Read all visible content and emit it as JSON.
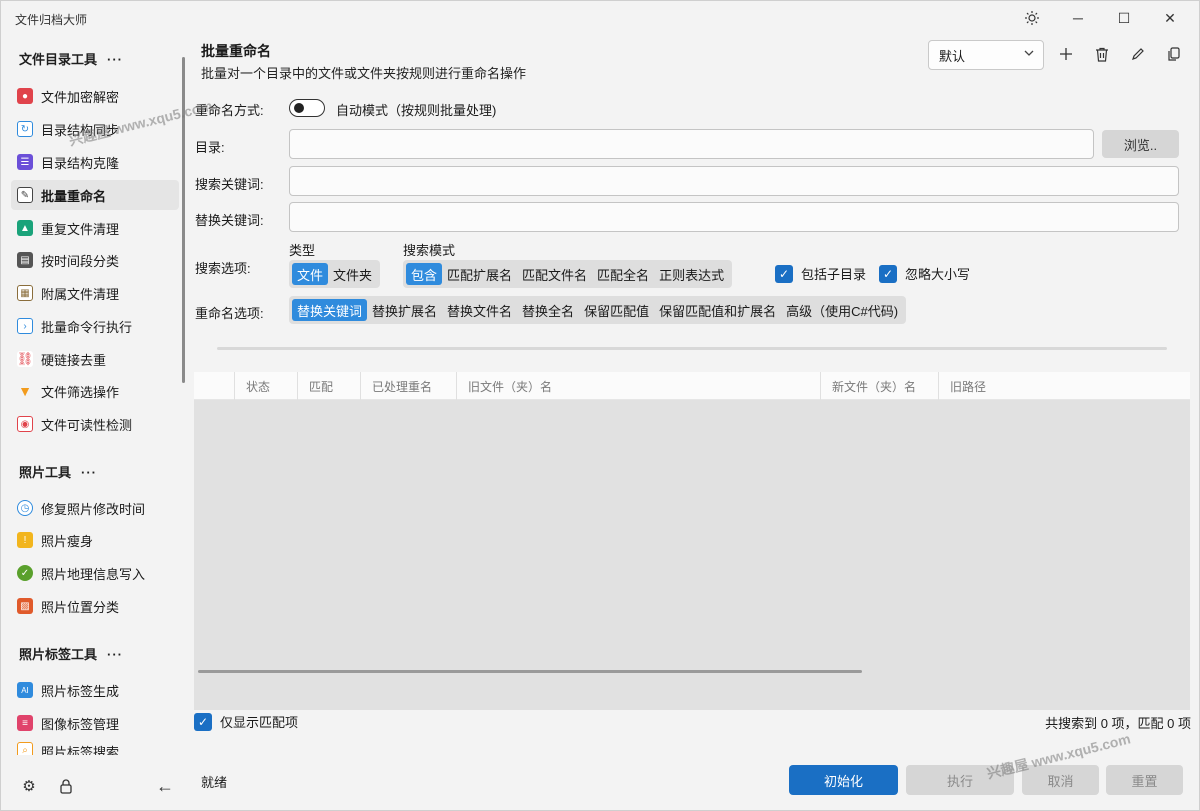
{
  "window": {
    "title": "文件归档大师",
    "theme_icon": "sun-icon",
    "minimize": "─",
    "maximize": "☐",
    "close": "✕"
  },
  "sidebar": {
    "groups": [
      {
        "title": "文件目录工具",
        "dots": "···",
        "items": [
          {
            "label": "文件加密解密",
            "icon": "lock-file-icon",
            "color": "#e0434b"
          },
          {
            "label": "目录结构同步",
            "icon": "sync-icon",
            "color": "#2f8bdd"
          },
          {
            "label": "目录结构克隆",
            "icon": "list-icon",
            "color": "#6b4fd8"
          },
          {
            "label": "批量重命名",
            "icon": "rename-icon",
            "color": "#444444"
          },
          {
            "label": "重复文件清理",
            "icon": "cleanup-icon",
            "color": "#1aa37a"
          },
          {
            "label": "按时间段分类",
            "icon": "printer-icon",
            "color": "#555555"
          },
          {
            "label": "附属文件清理",
            "icon": "document-icon",
            "color": "#8a6d3b"
          },
          {
            "label": "批量命令行执行",
            "icon": "terminal-icon",
            "color": "#2f8bdd"
          },
          {
            "label": "硬链接去重",
            "icon": "link-icon",
            "color": "#e0434b"
          },
          {
            "label": "文件筛选操作",
            "icon": "filter-icon",
            "color": "#f29b1d"
          },
          {
            "label": "文件可读性检测",
            "icon": "inspect-icon",
            "color": "#e0434b"
          }
        ]
      },
      {
        "title": "照片工具",
        "dots": "···",
        "items": [
          {
            "label": "修复照片修改时间",
            "icon": "clock-icon",
            "color": "#2f8bdd"
          },
          {
            "label": "照片瘦身",
            "icon": "compress-icon",
            "color": "#f2b51d"
          },
          {
            "label": "照片地理信息写入",
            "icon": "location-icon",
            "color": "#5aa02c"
          },
          {
            "label": "照片位置分类",
            "icon": "map-icon",
            "color": "#e05a2b"
          }
        ]
      },
      {
        "title": "照片标签工具",
        "dots": "···",
        "items": [
          {
            "label": "照片标签生成",
            "icon": "ai-tag-icon",
            "color": "#2f8bdd"
          },
          {
            "label": "图像标签管理",
            "icon": "tag-manage-icon",
            "color": "#e0436b"
          },
          {
            "label": "照片标签搜索",
            "icon": "tag-search-icon",
            "color": "#f29b1d"
          }
        ]
      }
    ],
    "bottom_icons": [
      "gear-icon",
      "lock-icon",
      "back-arrow-icon"
    ]
  },
  "header": {
    "title": "批量重命名",
    "subtitle": "批量对一个目录中的文件或文件夹按规则进行重命名操作",
    "preset_value": "默认",
    "toolbar_icons": [
      "add-icon",
      "delete-icon",
      "edit-icon",
      "copy-icon"
    ]
  },
  "form": {
    "mode_label": "重命名方式:",
    "mode_toggle_label": "自动模式（按规则批量处理)",
    "dir_label": "目录:",
    "dir_value": "",
    "browse_label": "浏览..",
    "search_label": "搜索关键词:",
    "search_value": "",
    "replace_label": "替换关键词:",
    "replace_value": "",
    "search_options_label": "搜索选项:",
    "type_label": "类型",
    "type_options": [
      {
        "label": "文件",
        "selected": true
      },
      {
        "label": "文件夹",
        "selected": false
      }
    ],
    "search_mode_label": "搜索模式",
    "search_mode_options": [
      {
        "label": "包含",
        "selected": true
      },
      {
        "label": "匹配扩展名",
        "selected": false
      },
      {
        "label": "匹配文件名",
        "selected": false
      },
      {
        "label": "匹配全名",
        "selected": false
      },
      {
        "label": "正则表达式",
        "selected": false
      }
    ],
    "include_subdirs_label": "包括子目录",
    "include_subdirs_checked": true,
    "ignore_case_label": "忽略大小写",
    "ignore_case_checked": true,
    "rename_options_label": "重命名选项:",
    "rename_options": [
      {
        "label": "替换关键词",
        "selected": true
      },
      {
        "label": "替换扩展名",
        "selected": false
      },
      {
        "label": "替换文件名",
        "selected": false
      },
      {
        "label": "替换全名",
        "selected": false
      },
      {
        "label": "保留匹配值",
        "selected": false
      },
      {
        "label": "保留匹配值和扩展名",
        "selected": false
      },
      {
        "label": "高级（使用C#代码)",
        "selected": false
      }
    ]
  },
  "table": {
    "columns": [
      "",
      "状态",
      "匹配",
      "已处理重名",
      "旧文件（夹）名",
      "新文件（夹）名",
      "旧路径"
    ],
    "rows": []
  },
  "footer": {
    "only_matched_label": "仅显示匹配项",
    "only_matched_checked": true,
    "summary": "共搜索到 0 项，匹配 0 项",
    "status": "就绪",
    "init_label": "初始化",
    "execute_label": "执行",
    "cancel_label": "取消",
    "reset_label": "重置"
  },
  "watermarks": [
    "兴趣屋 www.xqu5.com",
    "兴趣屋 www.xqu5.com"
  ],
  "colors": {
    "accent": "#1a6fc4",
    "segment_selected": "#2f8bdd"
  }
}
